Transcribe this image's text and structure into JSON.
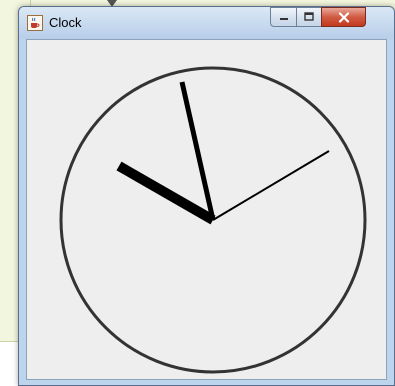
{
  "window": {
    "title": "Clock",
    "icon": "java-cup-icon",
    "controls": [
      "minimize-icon",
      "maximize-icon",
      "close-icon"
    ]
  },
  "clock": {
    "time_shown": "10:57:12",
    "face_color": "#333333",
    "background_color": "#eeeeee"
  }
}
